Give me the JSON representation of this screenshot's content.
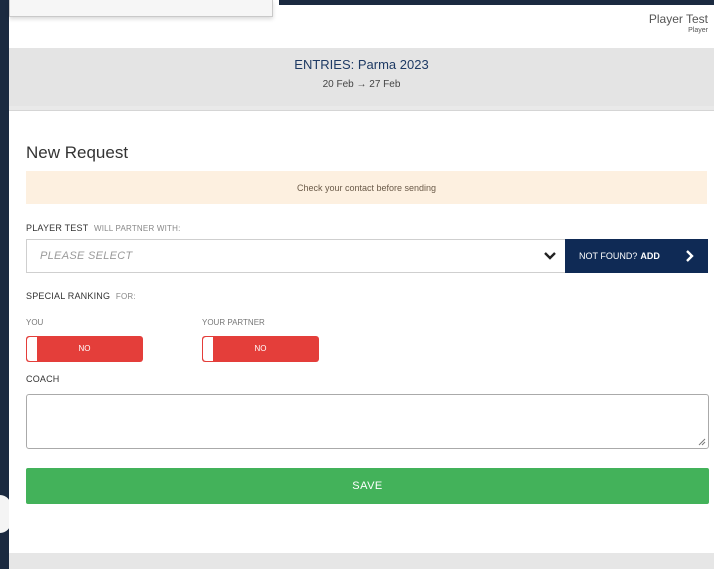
{
  "user": {
    "name": "Player Test",
    "role": "Player"
  },
  "entries": {
    "prefix": "ENTRIES:",
    "event": "Parma 2023",
    "date_from": "20 Feb",
    "date_sep": "→",
    "date_to": "27 Feb"
  },
  "form": {
    "title": "New Request",
    "notice": "Check your contact before sending",
    "partner_label_strong": "PLAYER TEST",
    "partner_label_muted": "WILL PARTNER WITH:",
    "partner_select_value": "PLEASE SELECT",
    "add_button_prefix": "NOT FOUND?",
    "add_button_action": "ADD",
    "ranking_label_strong": "SPECIAL RANKING",
    "ranking_label_muted": "FOR:",
    "you_label": "YOU",
    "you_toggle": "NO",
    "partner_label": "YOUR PARTNER",
    "partner_toggle": "NO",
    "coach_label": "COACH",
    "coach_value": "",
    "save_label": "SAVE"
  },
  "colors": {
    "navy": "#0f2a55",
    "save_green": "#43b25a",
    "toggle_red": "#e43e3a",
    "notice_bg": "#fdf0e0"
  }
}
